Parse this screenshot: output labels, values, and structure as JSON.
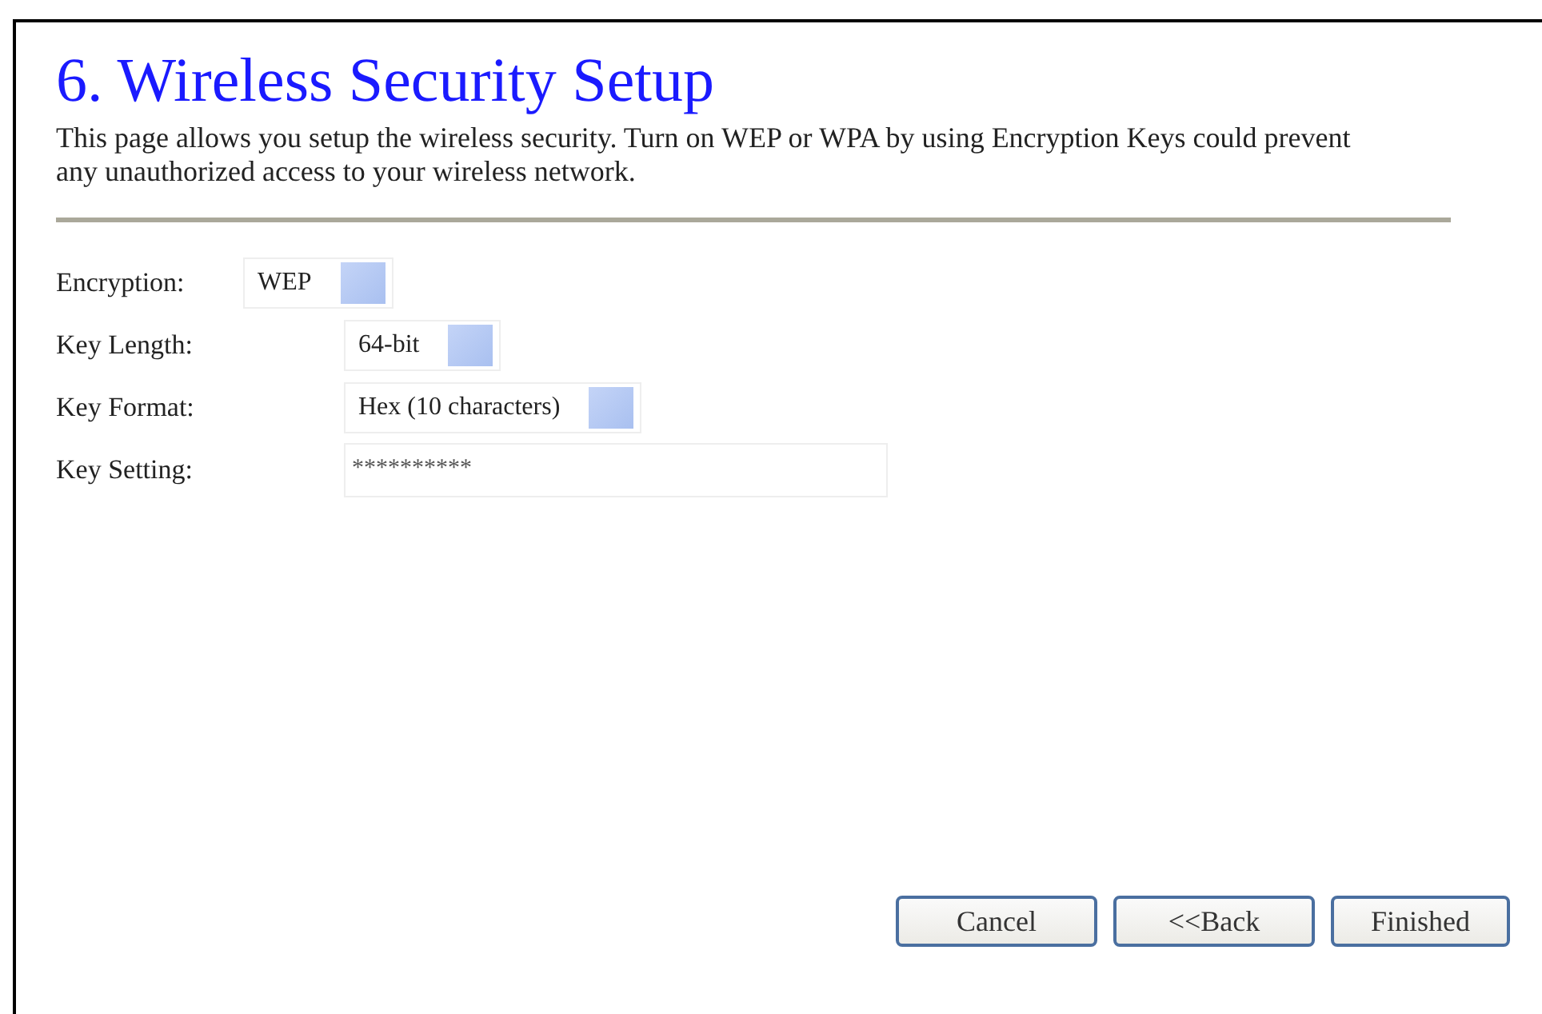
{
  "title": "6. Wireless Security Setup",
  "description": "This page allows you setup the wireless security. Turn on WEP or WPA by using Encryption Keys could prevent any unauthorized access to your wireless network.",
  "fields": [
    {
      "label": "Encryption:",
      "kind": "select",
      "value": "WEP"
    },
    {
      "label": "Key Length:",
      "kind": "select",
      "value": "64-bit"
    },
    {
      "label": "Key Format:",
      "kind": "select",
      "value": "Hex (10 characters)"
    },
    {
      "label": "Key Setting:",
      "kind": "text",
      "value": "**********"
    }
  ],
  "buttons": [
    "Cancel",
    "<<Back",
    "Finished"
  ]
}
